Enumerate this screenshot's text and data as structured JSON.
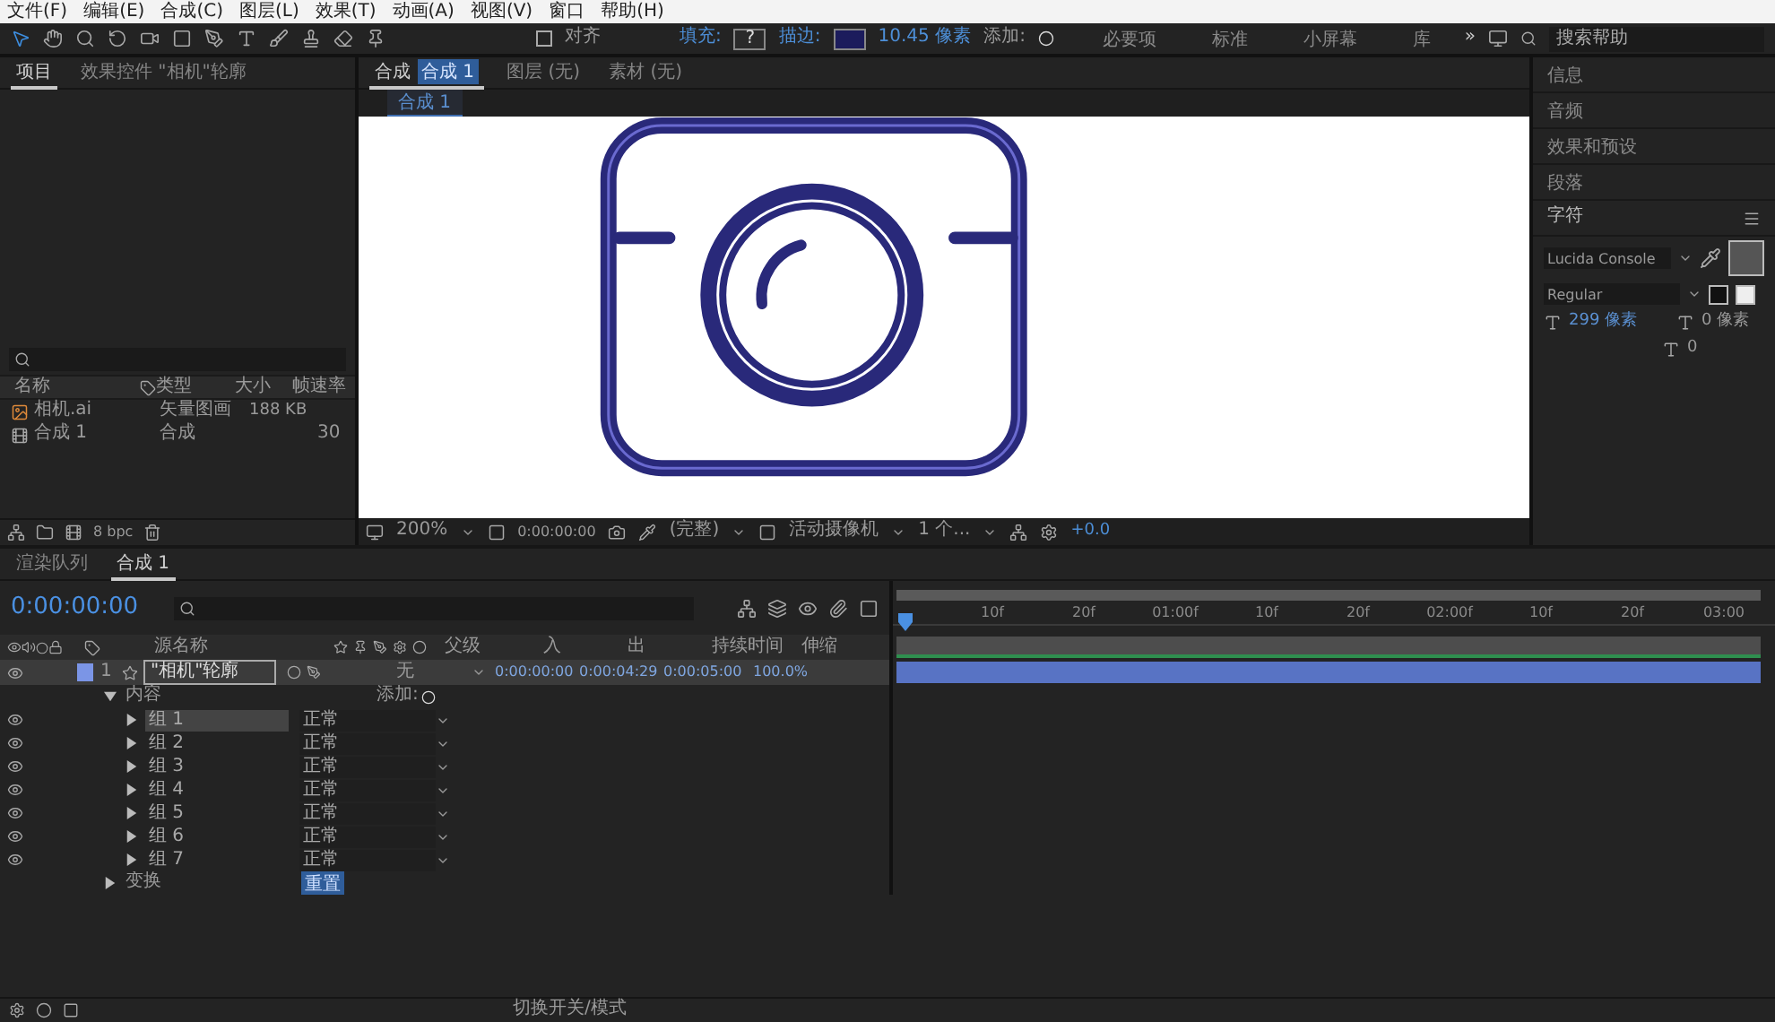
{
  "menu": [
    "文件(F)",
    "编辑(E)",
    "合成(C)",
    "图层(L)",
    "效果(T)",
    "动画(A)",
    "视图(V)",
    "窗口",
    "帮助(H)"
  ],
  "toolbar": {
    "align": {
      "label": "对齐",
      "checked": false
    },
    "fill_label": "填充:",
    "fill_value": "?",
    "stroke_label": "描边:",
    "stroke_width": "10.45 像素",
    "add_label": "添加:"
  },
  "workspaces": [
    {
      "label": "必要项",
      "selected": false
    },
    {
      "label": "标准",
      "selected": false
    },
    {
      "label": "小屏幕",
      "selected": false
    },
    {
      "label": "库",
      "selected": false
    }
  ],
  "workspace_more": "»",
  "help_search": {
    "placeholder": "搜索帮助"
  },
  "project_panel": {
    "tabs": [
      {
        "label": "项目",
        "selected": true
      },
      {
        "label": "效果控件 \"相机\"轮廓",
        "selected": false
      }
    ],
    "columns": [
      "名称",
      "类型",
      "大小",
      "帧速率"
    ],
    "rows": [
      {
        "kind": "footage",
        "name": "相机.ai",
        "type": "矢量图画",
        "size": "188 KB"
      },
      {
        "kind": "comp",
        "name": "合成 1",
        "type": "合成",
        "fps": "30"
      }
    ],
    "bit_depth": "8 bpc"
  },
  "viewer": {
    "tabs": [
      {
        "label": "合成",
        "target": "合成 1",
        "selected": true
      },
      {
        "label": "图层 (无)",
        "selected": false
      },
      {
        "label": "素材 (无)",
        "selected": false
      }
    ],
    "breadcrumb": "合成 1",
    "zoom": "200%",
    "timecode": "0:00:00:00",
    "resolution": "(完整)",
    "camera": "活动摄像机",
    "views": "1 个...",
    "exposure": "+0.0"
  },
  "right_panel": {
    "sections": [
      "信息",
      "音频",
      "效果和预设",
      "段落"
    ],
    "character": {
      "title": "字符",
      "font": "Lucida Console",
      "style": "Regular",
      "size": "299 像素",
      "leading": "0 像素",
      "tracking": "0"
    }
  },
  "timeline": {
    "tabs": [
      {
        "label": "渲染队列",
        "selected": false
      },
      {
        "label": "合成 1",
        "selected": true
      }
    ],
    "timecode": "0:00:00:00",
    "columns": {
      "source": "源名称",
      "parent": "父级",
      "in": "入",
      "out": "出",
      "duration": "持续时间",
      "stretch": "伸缩"
    },
    "layer": {
      "index": "1",
      "name": "\"相机\"轮廓",
      "parent": "无",
      "in": "0:00:00:00",
      "out": "0:00:04:29",
      "duration": "0:00:05:00",
      "stretch": "100.0%",
      "selected": true,
      "visible": true
    },
    "contents": {
      "label": "内容",
      "add": "添加:",
      "expanded": true,
      "groups": [
        {
          "name": "组 1",
          "mode": "正常",
          "selected": true,
          "expanded": false,
          "visible": true
        },
        {
          "name": "组 2",
          "mode": "正常",
          "selected": false,
          "expanded": false,
          "visible": true
        },
        {
          "name": "组 3",
          "mode": "正常",
          "selected": false,
          "expanded": false,
          "visible": true
        },
        {
          "name": "组 4",
          "mode": "正常",
          "selected": false,
          "expanded": false,
          "visible": true
        },
        {
          "name": "组 5",
          "mode": "正常",
          "selected": false,
          "expanded": false,
          "visible": true
        },
        {
          "name": "组 6",
          "mode": "正常",
          "selected": false,
          "expanded": false,
          "visible": true
        },
        {
          "name": "组 7",
          "mode": "正常",
          "selected": false,
          "expanded": false,
          "visible": true
        }
      ]
    },
    "transform": {
      "label": "变换",
      "reset": "重置",
      "expanded": false
    },
    "ruler": [
      "10f",
      "20f",
      "01:00f",
      "10f",
      "20f",
      "02:00f",
      "10f",
      "20f",
      "03:00"
    ],
    "footer": "切换开关/模式"
  }
}
